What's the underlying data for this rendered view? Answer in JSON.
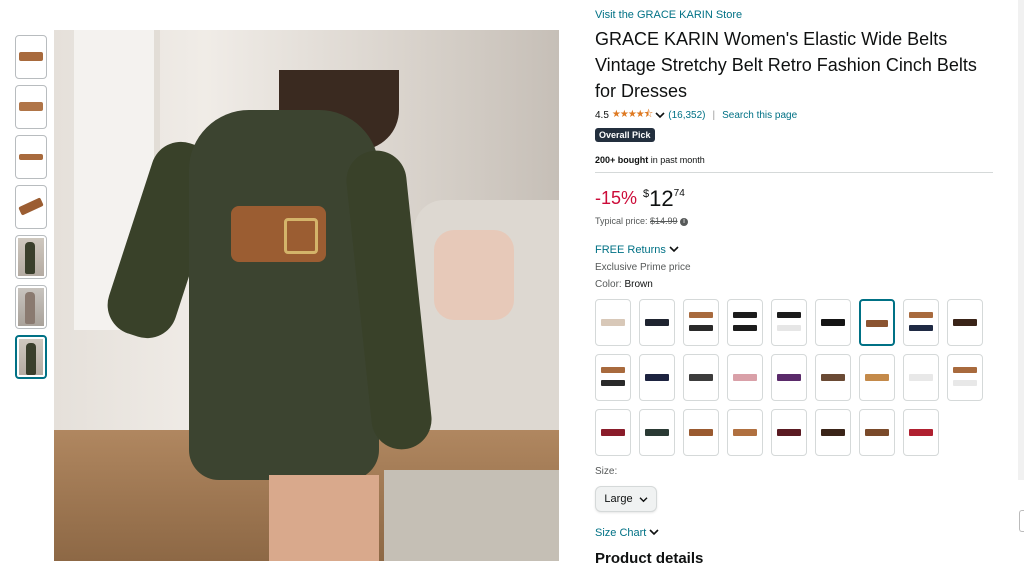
{
  "product": {
    "store_link": "Visit the GRACE KARIN Store",
    "title": "GRACE KARIN Women's Elastic Wide Belts Vintage Stretchy Belt Retro Fashion Cinch Belts for Dresses",
    "rating_value": "4.5",
    "stars_display": "★★★★⯪",
    "rating_count": "(16,352)",
    "search_page": "Search this page",
    "badge": "Overall Pick",
    "bought_strong": "200+ bought",
    "bought_rest": " in past month"
  },
  "price": {
    "discount": "-15%",
    "currency": "$",
    "whole": "12",
    "fraction": "74",
    "typical_label": "Typical price: ",
    "typical_value": "$14.99",
    "info_icon": "i"
  },
  "shipping": {
    "returns": "FREE Returns",
    "prime_price": "Exclusive Prime price"
  },
  "color": {
    "label": "Color: ",
    "selected": "Brown"
  },
  "swatches": [
    {
      "name": "swatch-1",
      "c1": "#d8c8b8",
      "c2": "",
      "c3": ""
    },
    {
      "name": "swatch-2",
      "c1": "#1f2430",
      "c2": "",
      "c3": ""
    },
    {
      "name": "swatch-3",
      "c1": "#a86a3d",
      "c2": "#2a2a2a",
      "c3": "#a86a3d"
    },
    {
      "name": "swatch-4",
      "c1": "#1c1c1c",
      "c2": "#1c1c1c",
      "c3": "#8a5a3a"
    },
    {
      "name": "swatch-5",
      "c1": "#1c1c1c",
      "c2": "#e6e6e6",
      "c3": "#e6e6e6"
    },
    {
      "name": "swatch-6",
      "c1": "#151515",
      "c2": "",
      "c3": ""
    },
    {
      "name": "swatch-7",
      "c1": "#8b5431",
      "c2": "",
      "c3": ""
    },
    {
      "name": "swatch-8",
      "c1": "#a86a3d",
      "c2": "#1f2a44",
      "c3": "#1f2a44"
    },
    {
      "name": "swatch-9",
      "c1": "#3a2418",
      "c2": "",
      "c3": ""
    },
    {
      "name": "swatch-10",
      "c1": "#a86a3d",
      "c2": "#2a2a2a",
      "c3": "#5a3520"
    },
    {
      "name": "swatch-11",
      "c1": "#1d2340",
      "c2": "",
      "c3": ""
    },
    {
      "name": "swatch-12",
      "c1": "#3c3c3c",
      "c2": "",
      "c3": ""
    },
    {
      "name": "swatch-13",
      "c1": "#d9a0a8",
      "c2": "",
      "c3": ""
    },
    {
      "name": "swatch-14",
      "c1": "#5a2a6a",
      "c2": "",
      "c3": ""
    },
    {
      "name": "swatch-15",
      "c1": "#6a4a34",
      "c2": "",
      "c3": ""
    },
    {
      "name": "swatch-16",
      "c1": "#c48a4a",
      "c2": "",
      "c3": ""
    },
    {
      "name": "swatch-17",
      "c1": "#e8e8e8",
      "c2": "",
      "c3": ""
    },
    {
      "name": "swatch-18",
      "c1": "#a86a3d",
      "c2": "#e8e8e8",
      "c3": "#e8e8e8"
    },
    {
      "name": "swatch-19",
      "c1": "#8a1c2a",
      "c2": "",
      "c3": ""
    },
    {
      "name": "swatch-20",
      "c1": "#2a3a34",
      "c2": "",
      "c3": ""
    },
    {
      "name": "swatch-21",
      "c1": "#9a5a30",
      "c2": "",
      "c3": ""
    },
    {
      "name": "swatch-22",
      "c1": "#b07040",
      "c2": "",
      "c3": ""
    },
    {
      "name": "swatch-23",
      "c1": "#5a1a22",
      "c2": "",
      "c3": ""
    },
    {
      "name": "swatch-24",
      "c1": "#3a2418",
      "c2": "",
      "c3": ""
    },
    {
      "name": "swatch-25",
      "c1": "#7a4a2a",
      "c2": "",
      "c3": ""
    },
    {
      "name": "swatch-26",
      "c1": "#b02030",
      "c2": "",
      "c3": ""
    }
  ],
  "size": {
    "label": "Size:",
    "selected": "Large",
    "size_chart": "Size Chart"
  },
  "sections": {
    "product_details": "Product details"
  },
  "icons": {
    "share": "share-icon",
    "chevron": "chevron-down-icon"
  },
  "colors": {
    "link": "#007185",
    "discount": "#cc0c39",
    "star": "#de7921",
    "badge_bg": "#232f3e"
  }
}
